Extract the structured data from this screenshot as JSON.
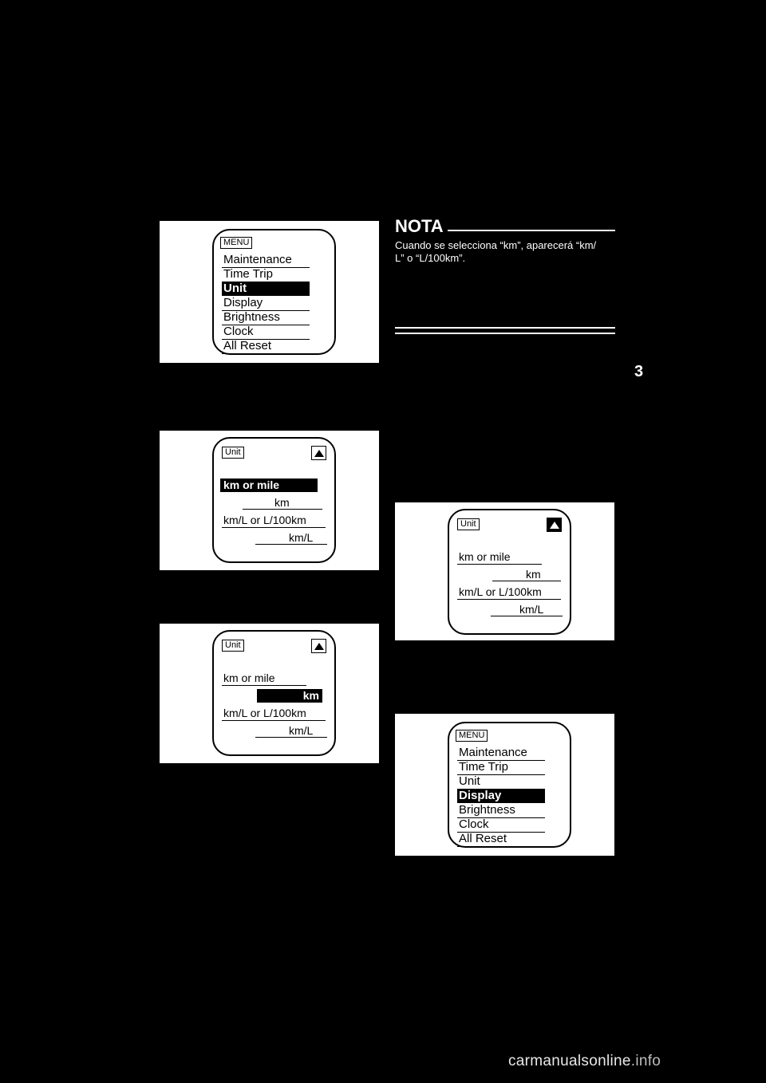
{
  "page": {
    "number": "3",
    "footer_brand": "carmanualsonline",
    "footer_suffix": ".info"
  },
  "note": {
    "heading": "NOTA",
    "line1": "Cuando se selecciona “km”, aparecerá “km/",
    "line2": "L” o “L/100km”."
  },
  "figures": {
    "menu_unit": {
      "badge": "MENU",
      "items": [
        {
          "label": "Maintenance",
          "selected": false
        },
        {
          "label": "Time Trip",
          "selected": false
        },
        {
          "label": "Unit",
          "selected": true
        },
        {
          "label": "Display",
          "selected": false
        },
        {
          "label": "Brightness",
          "selected": false
        },
        {
          "label": "Clock",
          "selected": false
        },
        {
          "label": "All Reset",
          "selected": false
        }
      ]
    },
    "menu_display": {
      "badge": "MENU",
      "items": [
        {
          "label": "Maintenance",
          "selected": false
        },
        {
          "label": "Time Trip",
          "selected": false
        },
        {
          "label": "Unit",
          "selected": false
        },
        {
          "label": "Display",
          "selected": true
        },
        {
          "label": "Brightness",
          "selected": false
        },
        {
          "label": "Clock",
          "selected": false
        },
        {
          "label": "All Reset",
          "selected": false
        }
      ]
    },
    "unit_km_or_mile_selected": {
      "badge": "Unit",
      "arrow": "up-arrow",
      "arrow_filled": false,
      "rows": [
        {
          "label": "km or mile",
          "selected": true
        },
        {
          "label": "km",
          "selected": false
        },
        {
          "label": "km/L or L/100km",
          "selected": false
        },
        {
          "label": "km/L",
          "selected": false
        }
      ]
    },
    "unit_km_selected": {
      "badge": "Unit",
      "arrow": "up-arrow",
      "arrow_filled": false,
      "rows": [
        {
          "label": "km or mile",
          "selected": false
        },
        {
          "label": "km",
          "selected": true
        },
        {
          "label": "km/L or L/100km",
          "selected": false
        },
        {
          "label": "km/L",
          "selected": false
        }
      ]
    },
    "unit_plain": {
      "badge": "Unit",
      "arrow": "up-arrow",
      "arrow_filled": true,
      "rows": [
        {
          "label": "km or mile",
          "selected": false
        },
        {
          "label": "km",
          "selected": false
        },
        {
          "label": "km/L or L/100km",
          "selected": false
        },
        {
          "label": "km/L",
          "selected": false
        }
      ]
    }
  }
}
